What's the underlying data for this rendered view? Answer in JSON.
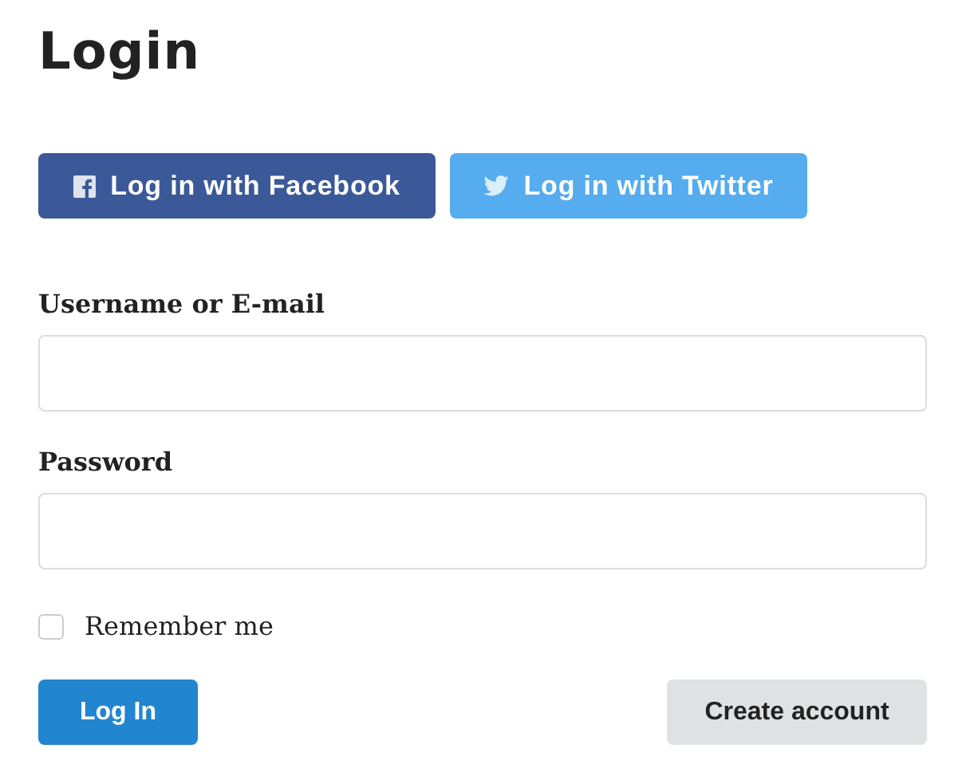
{
  "title": "Login",
  "social_buttons": [
    {
      "kind": "facebook",
      "label": "Log in with Facebook"
    },
    {
      "kind": "twitter",
      "label": "Log in with Twitter"
    }
  ],
  "fields": [
    {
      "label": "Username or E-mail"
    },
    {
      "label": "Password"
    }
  ],
  "remember": {
    "label": "Remember me",
    "checked": false
  },
  "buttons": [
    {
      "kind": "primary",
      "label": "Log In"
    },
    {
      "kind": "secondary",
      "label": "Create account"
    }
  ]
}
